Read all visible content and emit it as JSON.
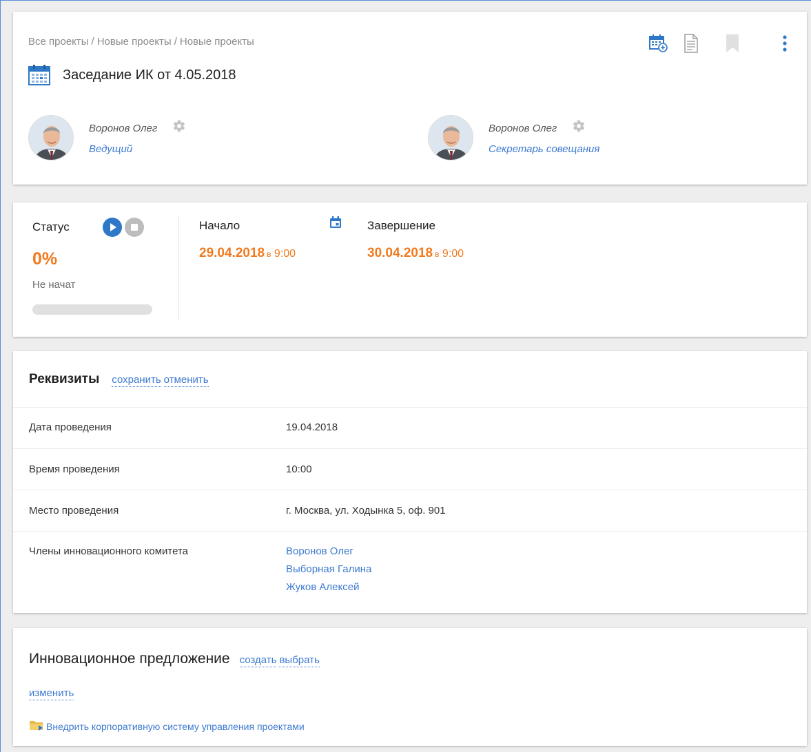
{
  "breadcrumb": {
    "items": [
      "Все проекты",
      "Новые проекты",
      "Новые проекты"
    ],
    "separator": "/"
  },
  "header": {
    "title": "Заседание ИК от 4.05.2018",
    "icons": [
      "calendar-add-icon",
      "document-icon",
      "bookmark-icon",
      "more-vert-icon"
    ]
  },
  "participants": [
    {
      "name": "Воронов Олег",
      "role": "Ведущий"
    },
    {
      "name": "Воронов Олег",
      "role": "Секретарь совещания"
    }
  ],
  "status": {
    "label": "Статус",
    "percent": "0%",
    "state": "Не начат",
    "progress_fraction": 0
  },
  "start": {
    "label": "Начало",
    "date": "29.04.2018",
    "at": "в",
    "time": "9:00"
  },
  "end": {
    "label": "Завершение",
    "date": "30.04.2018",
    "at": "в",
    "time": "9:00"
  },
  "requisites": {
    "title": "Реквизиты",
    "save_label": "сохранить",
    "cancel_label": "отменить",
    "rows": [
      {
        "key": "Дата проведения",
        "value": "19.04.2018"
      },
      {
        "key": "Время проведения",
        "value": "10:00"
      },
      {
        "key": "Место проведения",
        "value": "г. Москва, ул. Ходынка 5, оф. 901"
      },
      {
        "key": "Члены инновационного комитета"
      }
    ],
    "members": [
      "Воронов Олег",
      "Выборная Галина",
      "Жуков Алексей"
    ]
  },
  "innovation": {
    "title": "Инновационное предложение",
    "create_label": "создать",
    "select_label": "выбрать",
    "change_label": "изменить",
    "project_name": "Внедрить корпоративную систему управления проектами"
  },
  "colors": {
    "accent": "#3d7ad0",
    "orange": "#f07a1f",
    "background": "#eeeeee"
  }
}
